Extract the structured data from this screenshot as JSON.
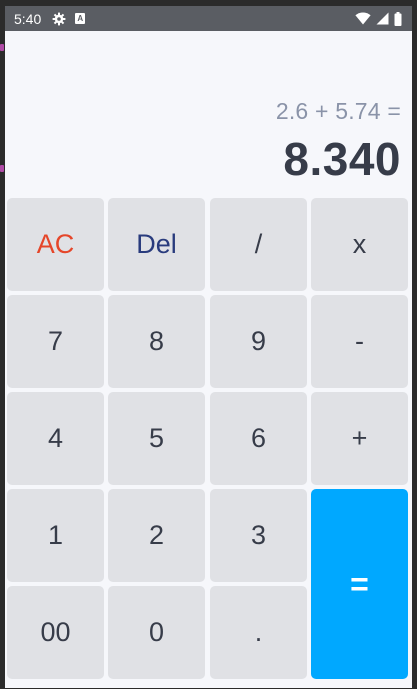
{
  "status_bar": {
    "time": "5:40",
    "icons": [
      "gear-icon",
      "a-icon",
      "wifi-icon",
      "signal-icon",
      "battery-icon"
    ]
  },
  "display": {
    "expression": "2.6 + 5.74 =",
    "result": "8.340"
  },
  "keypad": {
    "keys": [
      {
        "name": "ac",
        "label": "AC"
      },
      {
        "name": "del",
        "label": "Del"
      },
      {
        "name": "divide",
        "label": "/"
      },
      {
        "name": "multiply",
        "label": "x"
      },
      {
        "name": "seven",
        "label": "7"
      },
      {
        "name": "eight",
        "label": "8"
      },
      {
        "name": "nine",
        "label": "9"
      },
      {
        "name": "minus",
        "label": "-"
      },
      {
        "name": "four",
        "label": "4"
      },
      {
        "name": "five",
        "label": "5"
      },
      {
        "name": "six",
        "label": "6"
      },
      {
        "name": "plus",
        "label": "+"
      },
      {
        "name": "one",
        "label": "1"
      },
      {
        "name": "two",
        "label": "2"
      },
      {
        "name": "three",
        "label": "3"
      },
      {
        "name": "equals",
        "label": "="
      },
      {
        "name": "double-zero",
        "label": "00"
      },
      {
        "name": "zero",
        "label": "0"
      },
      {
        "name": "decimal",
        "label": "."
      }
    ]
  },
  "colors": {
    "status_bar": "#5a5d63",
    "background": "#f6f7fb",
    "key": "#e0e1e5",
    "key_text": "#373c49",
    "ac_text": "#e5462a",
    "del_text": "#293b7d",
    "equals_background": "#00a8ff",
    "expression_text": "#8a93a8"
  }
}
